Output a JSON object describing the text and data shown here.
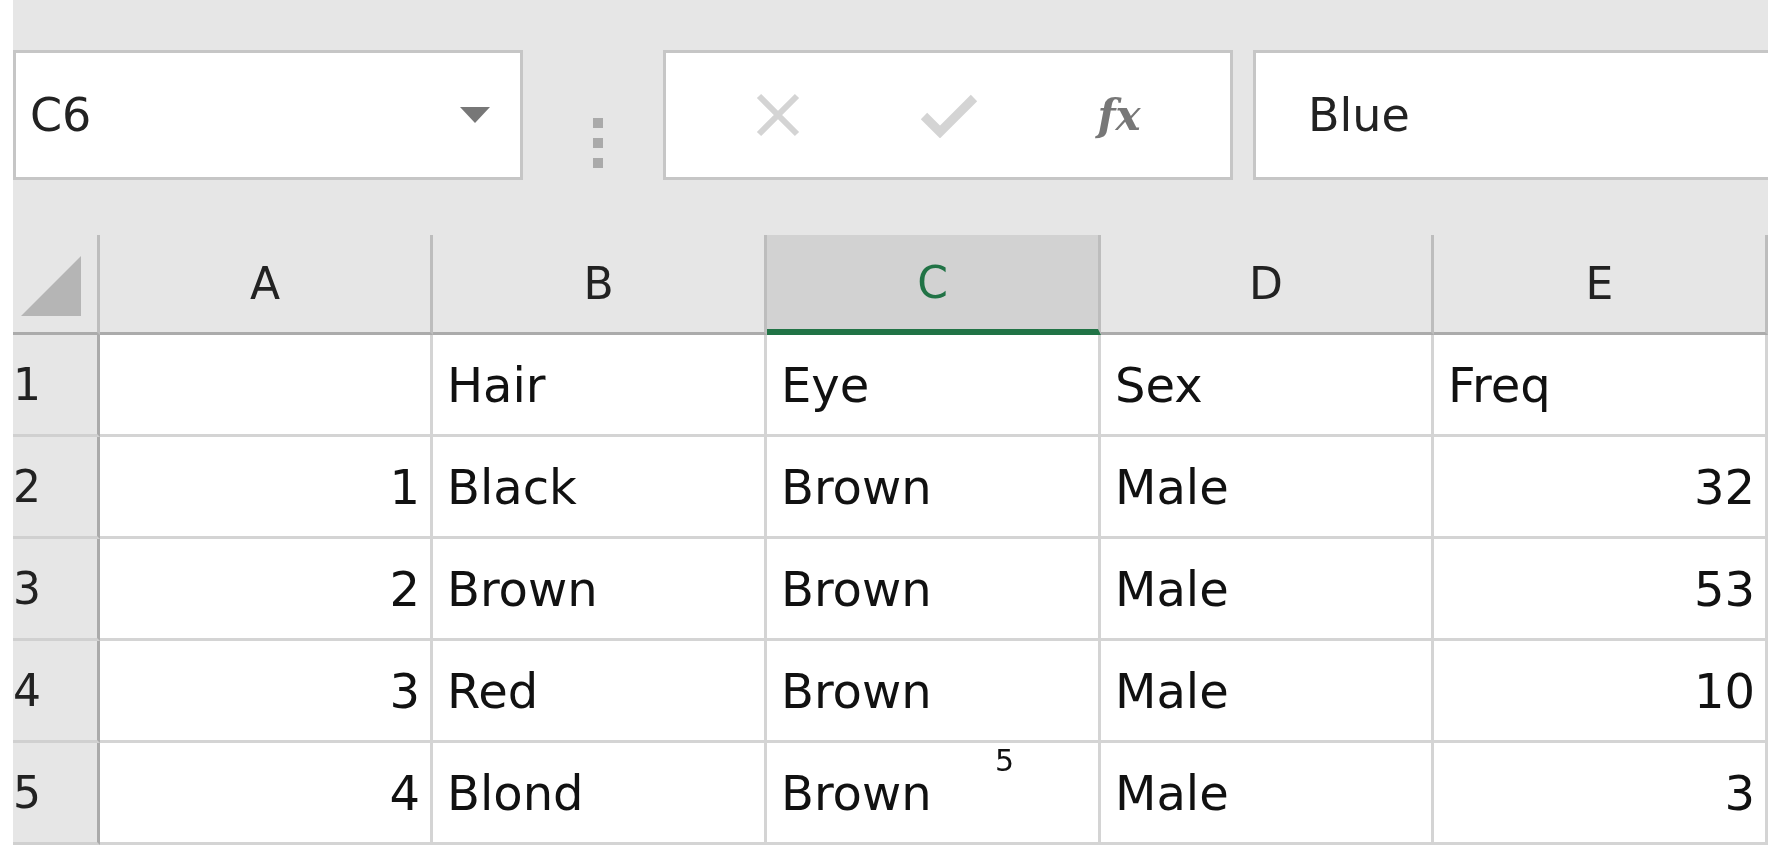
{
  "name_box": {
    "value": "C6"
  },
  "formula_bar": {
    "function_label": "fx",
    "value": "Blue"
  },
  "columns": [
    {
      "label": "A",
      "selected": false
    },
    {
      "label": "B",
      "selected": false
    },
    {
      "label": "C",
      "selected": true
    },
    {
      "label": "D",
      "selected": false
    },
    {
      "label": "E",
      "selected": false
    }
  ],
  "rows": [
    {
      "label": "1",
      "cells": [
        {
          "kind": "text",
          "text": ""
        },
        {
          "kind": "text",
          "text": "Hair"
        },
        {
          "kind": "text",
          "text": "Eye"
        },
        {
          "kind": "text",
          "text": "Sex"
        },
        {
          "kind": "text",
          "text": "Freq"
        }
      ]
    },
    {
      "label": "2",
      "cells": [
        {
          "kind": "number",
          "text": "1"
        },
        {
          "kind": "text",
          "text": "Black"
        },
        {
          "kind": "text",
          "text": "Brown"
        },
        {
          "kind": "text",
          "text": "Male"
        },
        {
          "kind": "number",
          "text": "32"
        }
      ]
    },
    {
      "label": "3",
      "cells": [
        {
          "kind": "number",
          "text": "2"
        },
        {
          "kind": "text",
          "text": "Brown"
        },
        {
          "kind": "text",
          "text": "Brown"
        },
        {
          "kind": "text",
          "text": "Male"
        },
        {
          "kind": "number",
          "text": "53"
        }
      ]
    },
    {
      "label": "4",
      "cells": [
        {
          "kind": "number",
          "text": "3"
        },
        {
          "kind": "text",
          "text": "Red"
        },
        {
          "kind": "text",
          "text": "Brown"
        },
        {
          "kind": "text",
          "text": "Male"
        },
        {
          "kind": "number",
          "text": "10"
        }
      ]
    },
    {
      "label": "5",
      "cells": [
        {
          "kind": "number",
          "text": "4"
        },
        {
          "kind": "text",
          "text": "Blond"
        },
        {
          "kind": "text",
          "text": "Brown",
          "annotation": "5"
        },
        {
          "kind": "text",
          "text": "Male"
        },
        {
          "kind": "number",
          "text": "3"
        }
      ]
    }
  ]
}
